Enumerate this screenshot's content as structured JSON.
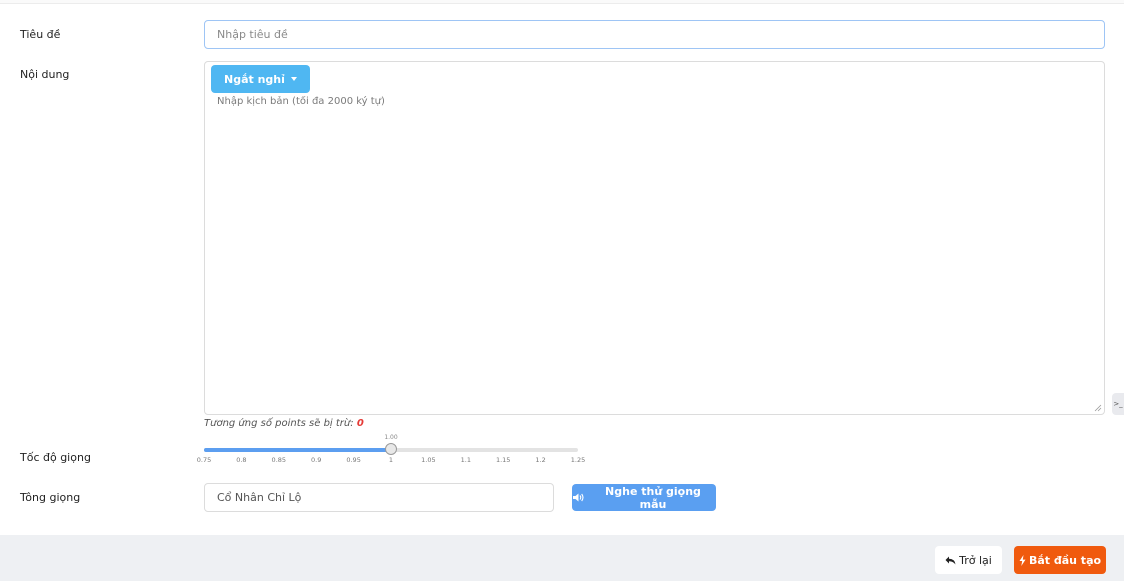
{
  "form": {
    "title_label": "Tiêu đề",
    "title_placeholder": "Nhập tiêu đề",
    "title_value": "",
    "content_label": "Nội dung",
    "pause_button_label": "Ngắt nghỉ",
    "script_placeholder": "Nhập kịch bản (tối đa 2000 ký tự)",
    "script_value": "",
    "points_note": "Tương ứng số points sẽ bị trừ:",
    "points_value": "0",
    "speed_label": "Tốc độ giọng",
    "speed": {
      "current_label": "1.00",
      "value": 1.0,
      "min": 0.75,
      "max": 1.25,
      "ticks": [
        "0.75",
        "0.8",
        "0.85",
        "0.9",
        "0.95",
        "1",
        "1.05",
        "1.1",
        "1.15",
        "1.2",
        "1.25"
      ]
    },
    "voice_label": "Tông giọng",
    "voice_value": "Cổ Nhân Chỉ Lộ",
    "listen_button_label": "Nghe thử giọng mẫu"
  },
  "footer": {
    "back_label": "Trở lại",
    "start_label": "Bắt đầu tạo"
  },
  "side_tab": {
    "label": ">_"
  },
  "icons": {
    "pause_caret": "caret-down-icon",
    "listen": "speaker-icon",
    "back": "reply-arrow-icon",
    "start": "lightning-bolt-icon"
  },
  "colors": {
    "primary_blue": "#5a9ff1",
    "pause_blue": "#4fb7f2",
    "start_orange": "#f05a0e",
    "points_red": "#e53935"
  }
}
